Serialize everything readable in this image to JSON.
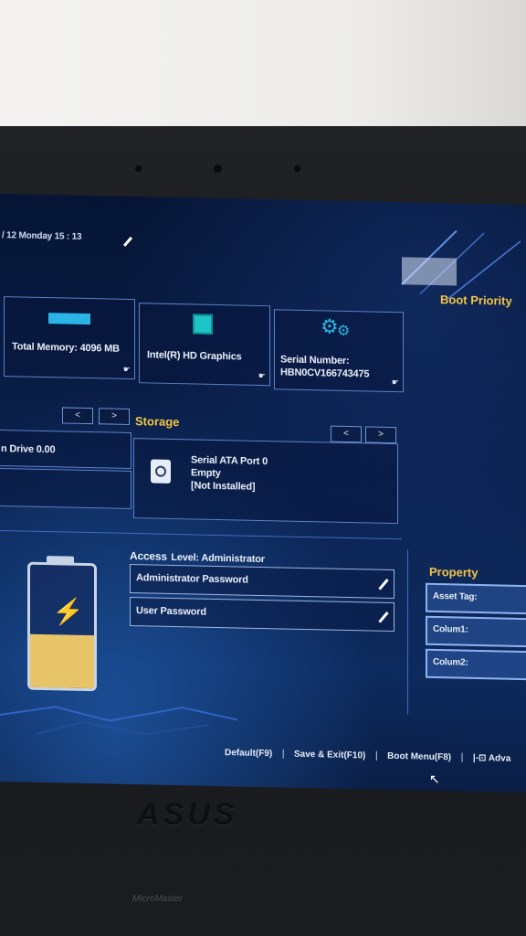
{
  "datetime": "/ 12 Monday 15 : 13",
  "boot_priority": "Boot Priority",
  "info_cards": [
    {
      "label": "Total Memory: 4096 MB",
      "icon": "memory-icon"
    },
    {
      "label": "Intel(R) HD Graphics",
      "icon": "graphics-chip-icon"
    },
    {
      "label_line1": "Serial Number:",
      "label_line2": "HBN0CV166743475",
      "icon": "gears-icon"
    }
  ],
  "left_drive": {
    "label": "n Drive 0.00"
  },
  "storage": {
    "title": "Storage",
    "port": "Serial ATA Port 0",
    "status": "Empty",
    "installed": "[Not Installed]"
  },
  "nav": {
    "prev": "<",
    "next": ">"
  },
  "security": {
    "access_title": "Access",
    "access_level": "Level: Administrator",
    "admin_password": "Administrator Password",
    "user_password": "User Password"
  },
  "property": {
    "title": "Property",
    "fields": [
      "Asset Tag:",
      "Colum1:",
      "Colum2:"
    ]
  },
  "footer": {
    "default": "Default(F9)",
    "save_exit": "Save & Exit(F10)",
    "boot_menu": "Boot Menu(F8)",
    "advanced": "|-⊡ Adva",
    "separator": "|"
  },
  "brand": "ASUS",
  "sticker": "MicroMaster",
  "colors": {
    "accent": "#f4c542",
    "panel_border": "#5a82c8",
    "battery_fill": "#e8c468"
  }
}
